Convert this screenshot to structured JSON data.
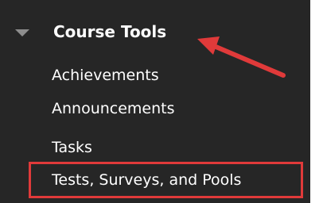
{
  "menu": {
    "heading": "Course Tools",
    "items": [
      {
        "label": "Achievements"
      },
      {
        "label": "Announcements"
      },
      {
        "label": "Tasks"
      },
      {
        "label": "Tests, Surveys, and Pools"
      }
    ]
  },
  "colors": {
    "panel_background": "#262626",
    "text": "#ffffff",
    "caret": "#8d8d8d",
    "annotation": "#e03a3a"
  },
  "icons": {
    "collapse_toggle": "caret-down-icon",
    "annotation_arrow": "red-arrow-icon"
  }
}
